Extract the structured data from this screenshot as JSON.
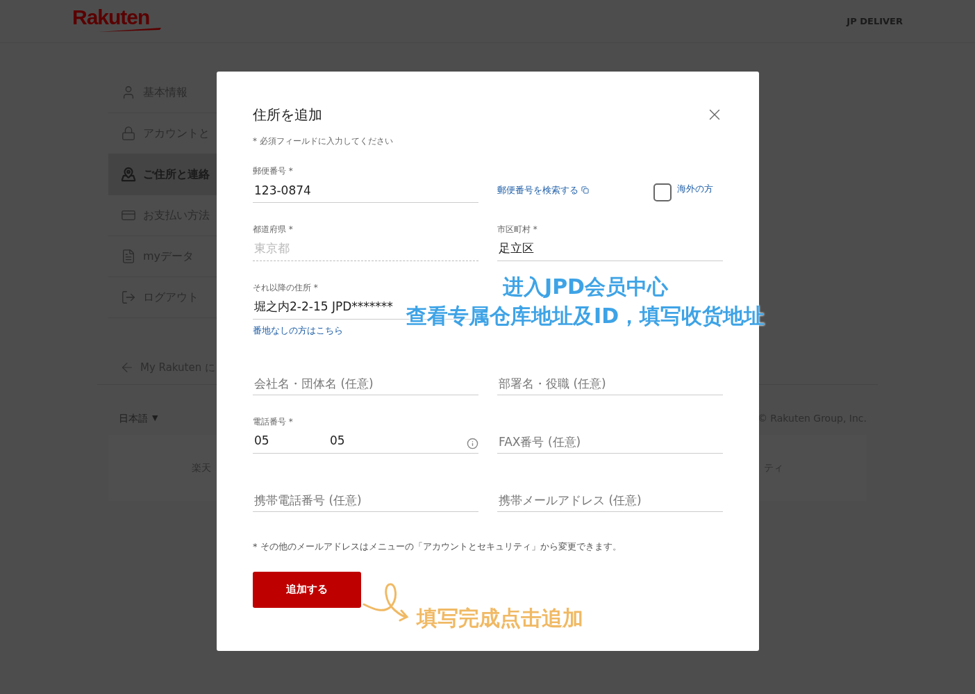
{
  "header": {
    "logo": "Rakuten",
    "user": "JP DELIVER"
  },
  "sidebar": {
    "items": [
      {
        "label": "基本情報",
        "selected": false
      },
      {
        "label": "アカウントと",
        "selected": false
      },
      {
        "label": "ご住所と連絡",
        "selected": true
      },
      {
        "label": "お支払い方法",
        "selected": false
      },
      {
        "label": "myデータ",
        "selected": false
      },
      {
        "label": "ログアウト",
        "selected": false
      }
    ],
    "back_link": "My Rakuten に"
  },
  "footer": {
    "language": "日本語",
    "language_caret": "▼",
    "copyright": "© Rakuten Group, Inc.",
    "links": [
      "楽天",
      "ティ"
    ]
  },
  "dialog": {
    "title": "住所を追加",
    "required_note": "* 必須フィールドに入力してください",
    "fields": [
      {
        "kind": "text",
        "label": "郵便番号 *",
        "value": "123-0874",
        "disabled": false
      },
      {
        "kind": "postal_tools",
        "link": "郵便番号を検索する",
        "checkbox_label": "海外の方",
        "checked": false
      },
      {
        "kind": "text",
        "label": "都道府県 *",
        "value": "東京都",
        "disabled": true
      },
      {
        "kind": "text",
        "label": "市区町村 *",
        "value": "足立区",
        "disabled": false
      },
      {
        "kind": "text",
        "label": "それ以降の住所 *",
        "value": "堀之内2-2-15 JPD*******",
        "disabled": false,
        "help_link": "番地なしの方はこちら"
      },
      {
        "kind": "empty"
      },
      {
        "kind": "text",
        "placeholder": "会社名・団体名 (任意)",
        "disabled": false
      },
      {
        "kind": "text",
        "placeholder": "部署名・役職 (任意)",
        "disabled": false
      },
      {
        "kind": "phone",
        "label": "電話番号 *",
        "values": [
          "05",
          "05"
        ]
      },
      {
        "kind": "text",
        "placeholder": "FAX番号 (任意)",
        "disabled": false
      },
      {
        "kind": "text",
        "placeholder": "携帯電話番号 (任意)",
        "disabled": false
      },
      {
        "kind": "text",
        "placeholder": "携帯メールアドレス (任意)",
        "disabled": false
      }
    ],
    "note": "* その他のメールアドレスはメニューの「アカウントとセキュリティ」から変更できます。",
    "submit": "追加する"
  },
  "annotations": [
    {
      "kind": "info",
      "lines": [
        "进入JPD会员中心",
        "查看专属仓库地址及ID，填写收货地址"
      ],
      "color": "#3ea3e6"
    },
    {
      "kind": "arrow",
      "lines": [
        "填写完成点击追加"
      ],
      "color": "#f0b964"
    }
  ]
}
